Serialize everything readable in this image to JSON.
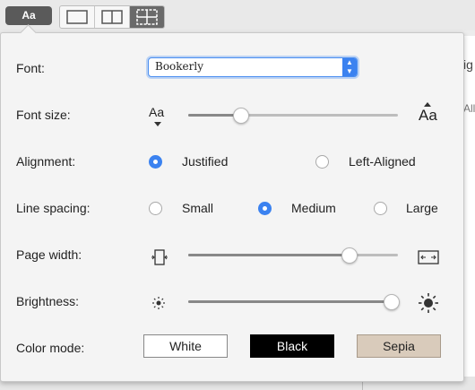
{
  "toolbar": {
    "font_button_label": "Aa",
    "layout_options": [
      "single-page",
      "two-page",
      "grid"
    ],
    "active_layout": "grid"
  },
  "background": {
    "partial_text_1": "ig",
    "partial_text_2": "All"
  },
  "settings": {
    "font": {
      "label": "Font:",
      "value": "Bookerly"
    },
    "font_size": {
      "label": "Font size:",
      "small_icon": "Aa",
      "large_icon": "Aa",
      "level": 0.25
    },
    "alignment": {
      "label": "Alignment:",
      "options": [
        "Justified",
        "Left-Aligned"
      ],
      "selected": "Justified"
    },
    "line_spacing": {
      "label": "Line spacing:",
      "options": [
        "Small",
        "Medium",
        "Large"
      ],
      "selected": "Medium"
    },
    "page_width": {
      "label": "Page width:",
      "level": 0.77
    },
    "brightness": {
      "label": "Brightness:",
      "level": 0.97
    },
    "color_mode": {
      "label": "Color mode:",
      "options": [
        {
          "label": "White",
          "bg": "#ffffff",
          "fg": "#222222"
        },
        {
          "label": "Black",
          "bg": "#000000",
          "fg": "#ffffff"
        },
        {
          "label": "Sepia",
          "bg": "#d9cbbb",
          "fg": "#222222"
        }
      ]
    }
  },
  "colors": {
    "accent": "#3b82f0"
  }
}
